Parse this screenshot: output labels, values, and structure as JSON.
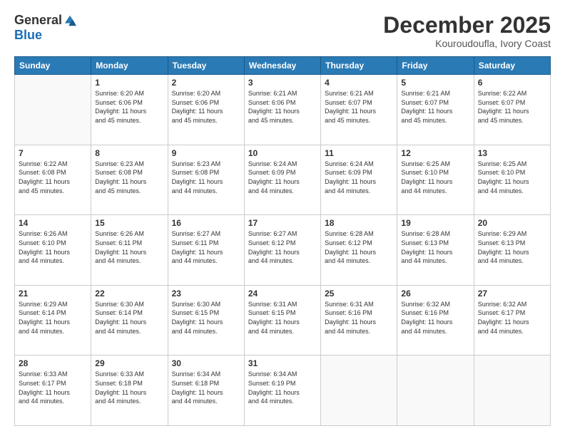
{
  "logo": {
    "general": "General",
    "blue": "Blue"
  },
  "header": {
    "month": "December 2025",
    "location": "Kouroudoufla, Ivory Coast"
  },
  "days_header": [
    "Sunday",
    "Monday",
    "Tuesday",
    "Wednesday",
    "Thursday",
    "Friday",
    "Saturday"
  ],
  "weeks": [
    [
      {
        "day": "",
        "info": ""
      },
      {
        "day": "1",
        "info": "Sunrise: 6:20 AM\nSunset: 6:06 PM\nDaylight: 11 hours\nand 45 minutes."
      },
      {
        "day": "2",
        "info": "Sunrise: 6:20 AM\nSunset: 6:06 PM\nDaylight: 11 hours\nand 45 minutes."
      },
      {
        "day": "3",
        "info": "Sunrise: 6:21 AM\nSunset: 6:06 PM\nDaylight: 11 hours\nand 45 minutes."
      },
      {
        "day": "4",
        "info": "Sunrise: 6:21 AM\nSunset: 6:07 PM\nDaylight: 11 hours\nand 45 minutes."
      },
      {
        "day": "5",
        "info": "Sunrise: 6:21 AM\nSunset: 6:07 PM\nDaylight: 11 hours\nand 45 minutes."
      },
      {
        "day": "6",
        "info": "Sunrise: 6:22 AM\nSunset: 6:07 PM\nDaylight: 11 hours\nand 45 minutes."
      }
    ],
    [
      {
        "day": "7",
        "info": "Sunrise: 6:22 AM\nSunset: 6:08 PM\nDaylight: 11 hours\nand 45 minutes."
      },
      {
        "day": "8",
        "info": "Sunrise: 6:23 AM\nSunset: 6:08 PM\nDaylight: 11 hours\nand 45 minutes."
      },
      {
        "day": "9",
        "info": "Sunrise: 6:23 AM\nSunset: 6:08 PM\nDaylight: 11 hours\nand 44 minutes."
      },
      {
        "day": "10",
        "info": "Sunrise: 6:24 AM\nSunset: 6:09 PM\nDaylight: 11 hours\nand 44 minutes."
      },
      {
        "day": "11",
        "info": "Sunrise: 6:24 AM\nSunset: 6:09 PM\nDaylight: 11 hours\nand 44 minutes."
      },
      {
        "day": "12",
        "info": "Sunrise: 6:25 AM\nSunset: 6:10 PM\nDaylight: 11 hours\nand 44 minutes."
      },
      {
        "day": "13",
        "info": "Sunrise: 6:25 AM\nSunset: 6:10 PM\nDaylight: 11 hours\nand 44 minutes."
      }
    ],
    [
      {
        "day": "14",
        "info": "Sunrise: 6:26 AM\nSunset: 6:10 PM\nDaylight: 11 hours\nand 44 minutes."
      },
      {
        "day": "15",
        "info": "Sunrise: 6:26 AM\nSunset: 6:11 PM\nDaylight: 11 hours\nand 44 minutes."
      },
      {
        "day": "16",
        "info": "Sunrise: 6:27 AM\nSunset: 6:11 PM\nDaylight: 11 hours\nand 44 minutes."
      },
      {
        "day": "17",
        "info": "Sunrise: 6:27 AM\nSunset: 6:12 PM\nDaylight: 11 hours\nand 44 minutes."
      },
      {
        "day": "18",
        "info": "Sunrise: 6:28 AM\nSunset: 6:12 PM\nDaylight: 11 hours\nand 44 minutes."
      },
      {
        "day": "19",
        "info": "Sunrise: 6:28 AM\nSunset: 6:13 PM\nDaylight: 11 hours\nand 44 minutes."
      },
      {
        "day": "20",
        "info": "Sunrise: 6:29 AM\nSunset: 6:13 PM\nDaylight: 11 hours\nand 44 minutes."
      }
    ],
    [
      {
        "day": "21",
        "info": "Sunrise: 6:29 AM\nSunset: 6:14 PM\nDaylight: 11 hours\nand 44 minutes."
      },
      {
        "day": "22",
        "info": "Sunrise: 6:30 AM\nSunset: 6:14 PM\nDaylight: 11 hours\nand 44 minutes."
      },
      {
        "day": "23",
        "info": "Sunrise: 6:30 AM\nSunset: 6:15 PM\nDaylight: 11 hours\nand 44 minutes."
      },
      {
        "day": "24",
        "info": "Sunrise: 6:31 AM\nSunset: 6:15 PM\nDaylight: 11 hours\nand 44 minutes."
      },
      {
        "day": "25",
        "info": "Sunrise: 6:31 AM\nSunset: 6:16 PM\nDaylight: 11 hours\nand 44 minutes."
      },
      {
        "day": "26",
        "info": "Sunrise: 6:32 AM\nSunset: 6:16 PM\nDaylight: 11 hours\nand 44 minutes."
      },
      {
        "day": "27",
        "info": "Sunrise: 6:32 AM\nSunset: 6:17 PM\nDaylight: 11 hours\nand 44 minutes."
      }
    ],
    [
      {
        "day": "28",
        "info": "Sunrise: 6:33 AM\nSunset: 6:17 PM\nDaylight: 11 hours\nand 44 minutes."
      },
      {
        "day": "29",
        "info": "Sunrise: 6:33 AM\nSunset: 6:18 PM\nDaylight: 11 hours\nand 44 minutes."
      },
      {
        "day": "30",
        "info": "Sunrise: 6:34 AM\nSunset: 6:18 PM\nDaylight: 11 hours\nand 44 minutes."
      },
      {
        "day": "31",
        "info": "Sunrise: 6:34 AM\nSunset: 6:19 PM\nDaylight: 11 hours\nand 44 minutes."
      },
      {
        "day": "",
        "info": ""
      },
      {
        "day": "",
        "info": ""
      },
      {
        "day": "",
        "info": ""
      }
    ]
  ]
}
